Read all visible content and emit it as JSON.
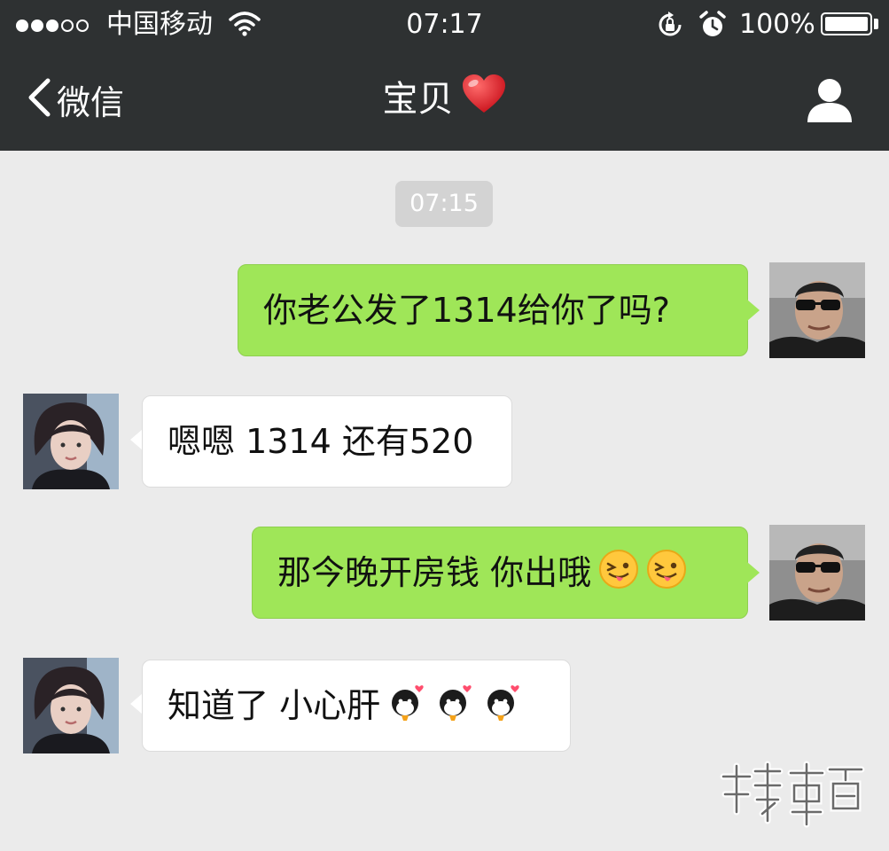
{
  "status_bar": {
    "carrier": "中国移动",
    "signal_bars_filled": 3,
    "signal_bars_total": 5,
    "time": "07:17",
    "battery": "100%",
    "battery_level": 1.0
  },
  "nav": {
    "back_label": "微信",
    "title": "宝贝",
    "title_icon": "heart-icon",
    "right_icon": "person-icon"
  },
  "chat": {
    "timestamp": "07:15",
    "messages": [
      {
        "direction": "out",
        "text": "你老公发了1314给你了吗?",
        "emojis": []
      },
      {
        "direction": "in",
        "text": "嗯嗯 1314 还有520",
        "emojis": []
      },
      {
        "direction": "out",
        "text": "那今晚开房钱 你出哦",
        "emojis": [
          "tongue-wink-emoji",
          "tongue-wink-emoji"
        ]
      },
      {
        "direction": "in",
        "text": "知道了 小心肝",
        "emojis": [
          "kiss-emoji",
          "kiss-emoji",
          "kiss-emoji"
        ]
      }
    ]
  },
  "watermark": {
    "name": "watermark-logo",
    "text": "搜事百科"
  },
  "colors": {
    "bar_bg": "#2e3132",
    "chat_bg": "#ebebeb",
    "out_bubble": "#9fe658",
    "in_bubble": "#ffffff",
    "timestamp_bg": "#d3d3d3"
  }
}
